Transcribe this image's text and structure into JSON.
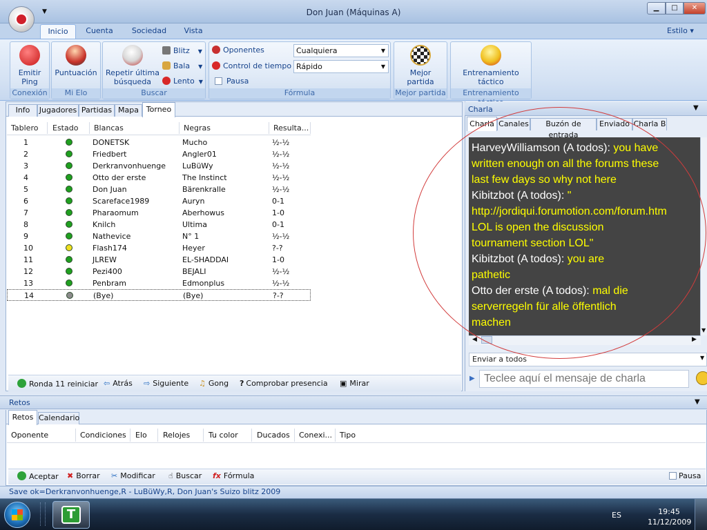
{
  "window": {
    "title": "Don Juan (Máquinas A)",
    "min": "▁",
    "max": "□",
    "close": "✕"
  },
  "ribbon_tabs": [
    "Inicio",
    "Cuenta",
    "Sociedad",
    "Vista"
  ],
  "estilo": "Estilo",
  "ribbon": {
    "conexion": {
      "button": "Emitir\nPing",
      "caption": "Conexión"
    },
    "mi_elo": {
      "button": "Puntuación",
      "caption": "Mi Elo"
    },
    "buscar": {
      "button": "Repetir última\nbúsqueda",
      "blitz": "Blitz",
      "bala": "Bala",
      "lento": "Lento",
      "caption": "Buscar"
    },
    "formula": {
      "oponentes_label": "Oponentes",
      "oponentes_value": "Cualquiera",
      "control_label": "Control de tiempo",
      "control_value": "Rápido",
      "pausa": "Pausa",
      "caption": "Fórmula"
    },
    "mejor_partida": {
      "button": "Mejor\npartida",
      "caption": "Mejor partida"
    },
    "entrenamiento": {
      "button": "Entrenamiento\ntáctico",
      "caption": "Entrenamiento táctico"
    }
  },
  "left_tabs": [
    "Info",
    "Jugadores",
    "Partidas",
    "Mapa",
    "Torneo"
  ],
  "tournament": {
    "columns": [
      "Tablero",
      "Estado",
      "Blancas",
      "Negras",
      "Resulta..."
    ],
    "rows": [
      {
        "tablero": "1",
        "estado": "green",
        "blancas": "DONETSK",
        "negras": "Mucho",
        "resultado": "½-½"
      },
      {
        "tablero": "2",
        "estado": "green",
        "blancas": "Friedbert",
        "negras": "Angler01",
        "resultado": "½-½"
      },
      {
        "tablero": "3",
        "estado": "green",
        "blancas": "Derkranvonhuenge",
        "negras": "LuBüWy",
        "resultado": "½-½"
      },
      {
        "tablero": "4",
        "estado": "green",
        "blancas": "Otto der erste",
        "negras": "The Instinct",
        "resultado": "½-½"
      },
      {
        "tablero": "5",
        "estado": "green",
        "blancas": "Don Juan",
        "negras": "Bärenkralle",
        "resultado": "½-½"
      },
      {
        "tablero": "6",
        "estado": "green",
        "blancas": "Scareface1989",
        "negras": "Auryn",
        "resultado": "0-1"
      },
      {
        "tablero": "7",
        "estado": "green",
        "blancas": "Pharaomum",
        "negras": "Aberhowus",
        "resultado": "1-0"
      },
      {
        "tablero": "8",
        "estado": "green",
        "blancas": "Knilch",
        "negras": "Ultima",
        "resultado": "0-1"
      },
      {
        "tablero": "9",
        "estado": "green",
        "blancas": "Nathevice",
        "negras": "N° 1",
        "resultado": "½-½"
      },
      {
        "tablero": "10",
        "estado": "yellow",
        "blancas": "Flash174",
        "negras": "Heyer",
        "resultado": "?-?"
      },
      {
        "tablero": "11",
        "estado": "green",
        "blancas": "JLREW",
        "negras": "EL-SHADDAI",
        "resultado": "1-0"
      },
      {
        "tablero": "12",
        "estado": "green",
        "blancas": "Pezi400",
        "negras": "BEJALI",
        "resultado": "½-½"
      },
      {
        "tablero": "13",
        "estado": "green",
        "blancas": "Penbram",
        "negras": "Edmonplus",
        "resultado": "½-½"
      },
      {
        "tablero": "14",
        "estado": "gray",
        "blancas": "(Bye)",
        "negras": "(Bye)",
        "resultado": "?-?"
      }
    ]
  },
  "left_toolbar": [
    "Ronda 11 reiniciar",
    "Atrás",
    "Siguiente",
    "Gong",
    "Comprobar presencia",
    "Mirar"
  ],
  "charla": {
    "header": "Charla",
    "tabs": [
      "Charla",
      "Canales",
      "Buzón de entrada",
      "Enviado",
      "Charla B"
    ],
    "lines": [
      {
        "w": "HarveyWilliamson (A todos):  ",
        "y": "you have"
      },
      {
        "w": "",
        "y": "written enough on all the forums these"
      },
      {
        "w": "",
        "y": "last few days so why not here"
      },
      {
        "w": "Kibitzbot (A todos):  ",
        "y": "\""
      },
      {
        "w": "",
        "y": "http://jordiqui.forumotion.com/forum.htm"
      },
      {
        "w": "",
        "y": "LOL is open the discussion"
      },
      {
        "w": "",
        "y": "tournament section LOL\""
      },
      {
        "w": "Kibitzbot (A todos):  ",
        "y": "you are"
      },
      {
        "w": "",
        "y": "pathetic"
      },
      {
        "w": "Otto der erste (A todos):  ",
        "y": "mal die"
      },
      {
        "w": "",
        "y": "serverregeln für alle öffentlich"
      },
      {
        "w": "",
        "y": "machen"
      }
    ],
    "send_to": "Enviar a todos",
    "input_placeholder": "Teclee aquí el mensaje de charla"
  },
  "retos": {
    "header": "Retos",
    "tabs": [
      "Retos",
      "Calendario"
    ],
    "columns": [
      "Oponente",
      "Condiciones",
      "Elo",
      "Relojes",
      "Tu color",
      "Ducados",
      "Conexi...",
      "Tipo"
    ],
    "toolbar": [
      "Aceptar",
      "Borrar",
      "Modificar",
      "Buscar",
      "Fórmula"
    ],
    "pausa": "Pausa"
  },
  "status": "Save ok=Derkranvonhuenge,R - LuBüWy,R, Don Juan's Suizo blitz 2009",
  "taskbar": {
    "lang": "ES",
    "time": "19:45",
    "date": "11/12/2009",
    "app_letter": "T"
  }
}
